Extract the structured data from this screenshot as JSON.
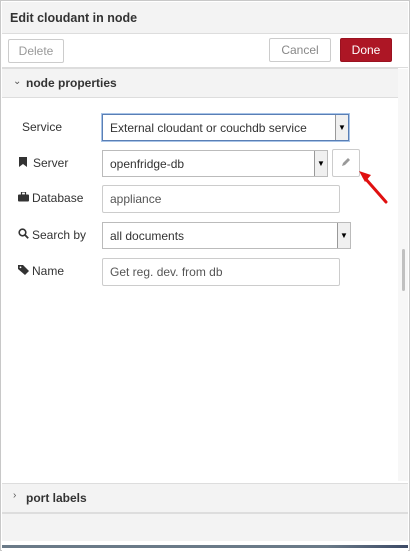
{
  "dialog": {
    "title": "Edit cloudant in node"
  },
  "toolbar": {
    "delete_label": "Delete",
    "cancel_label": "Cancel",
    "done_label": "Done"
  },
  "sections": {
    "node_properties": "node properties",
    "port_labels": "port labels"
  },
  "form": {
    "service": {
      "label": "Service",
      "value": "External cloudant or couchdb service"
    },
    "server": {
      "label": "Server",
      "value": "openfridge-db"
    },
    "database": {
      "label": "Database",
      "value": "appliance"
    },
    "search_by": {
      "label": "Search by",
      "value": "all documents"
    },
    "name": {
      "label": "Name",
      "value": "Get reg. dev. from db"
    }
  },
  "colors": {
    "done_button": "#ad1625",
    "annotation_arrow": "#e01010",
    "focus_border": "#5a7fb5"
  },
  "icons": {
    "server": "bookmark-icon",
    "database": "briefcase-icon",
    "search_by": "search-icon",
    "name": "tag-icon",
    "edit": "pencil-icon"
  }
}
